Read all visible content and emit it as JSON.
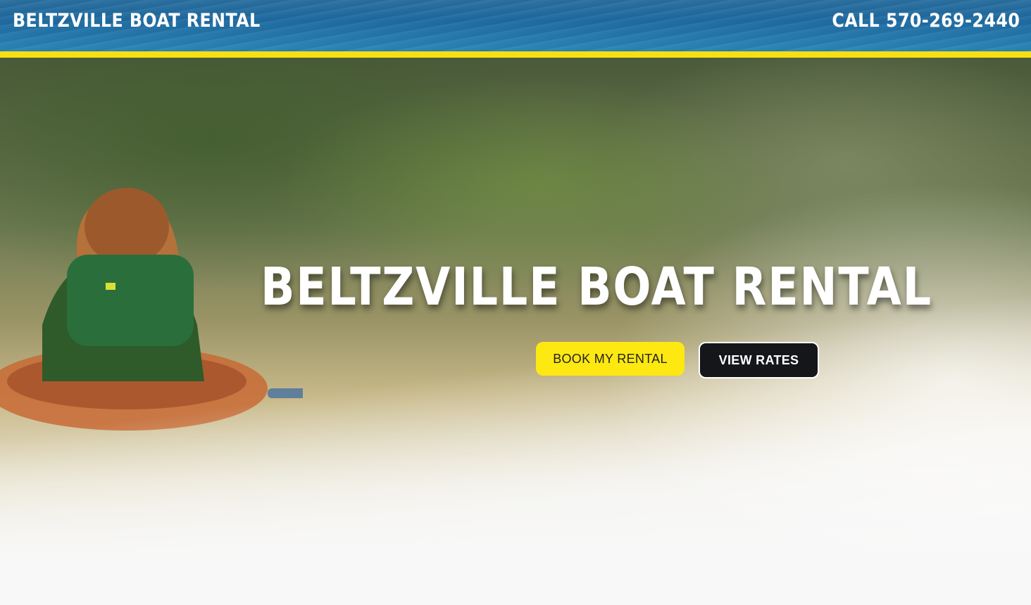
{
  "header": {
    "brand": "BELTZVILLE BOAT RENTAL",
    "phone": "CALL 570-269-2440"
  },
  "hero": {
    "title": "BELTZVILLE BOAT RENTAL",
    "book_label": "BOOK MY RENTAL",
    "rates_label": "VIEW RATES",
    "image_subject": "kayaker-paddling-on-lake"
  },
  "colors": {
    "accent_yellow": "#F7DF13",
    "button_yellow": "#FDE812",
    "button_dark": "#15161A",
    "header_blue": "#1F6AA0"
  }
}
